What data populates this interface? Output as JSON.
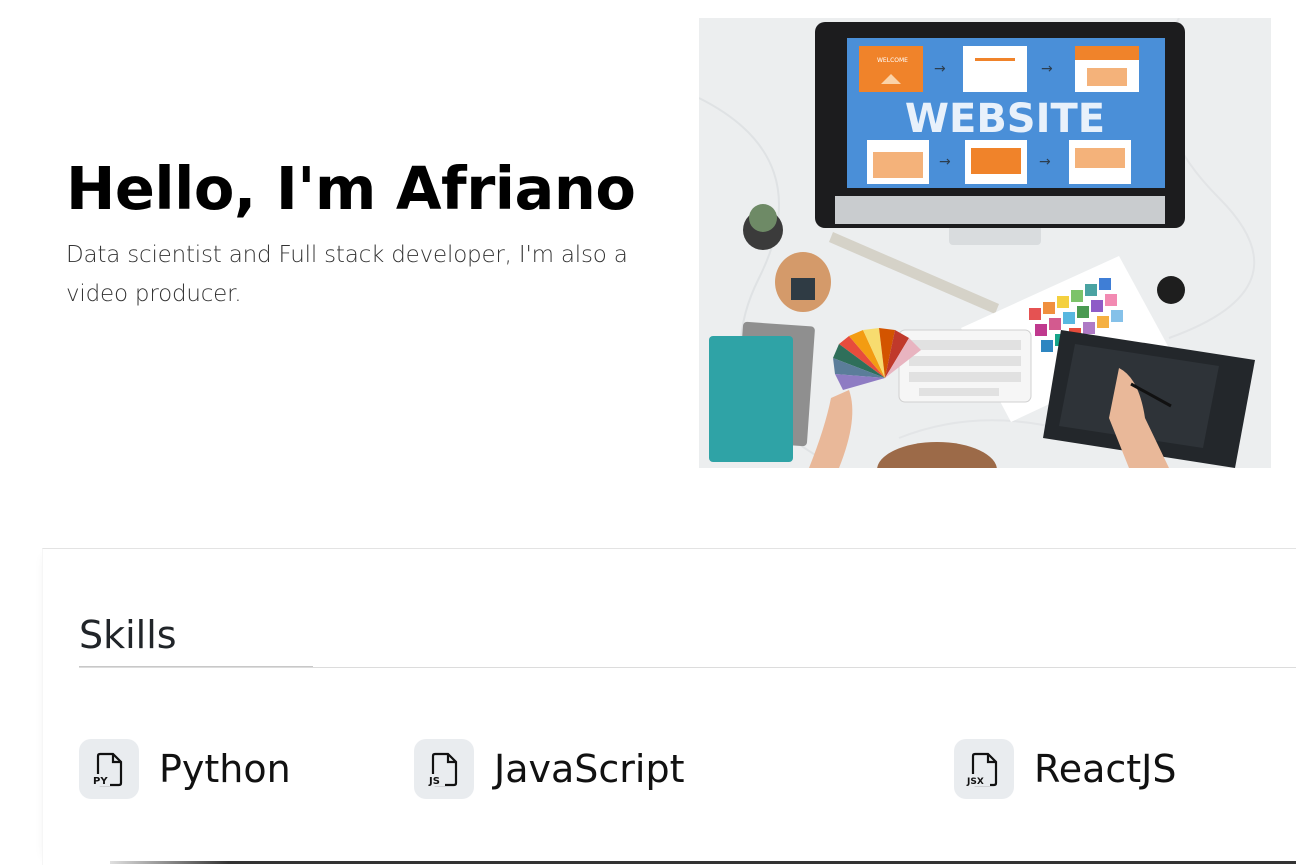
{
  "hero": {
    "title": "Hello, I'm Afriano",
    "subtitle": "Data scientist and Full stack developer, I'm also a video producer.",
    "image": {
      "monitor_text": "WEBSITE",
      "monitor_welcome": "WELCOME"
    }
  },
  "skills": {
    "heading": "Skills",
    "items": [
      {
        "label": "Python",
        "icon": "file-py-icon",
        "icon_text": "PY"
      },
      {
        "label": "JavaScript",
        "icon": "file-js-icon",
        "icon_text": "JS"
      },
      {
        "label": "ReactJS",
        "icon": "file-jsx-icon",
        "icon_text": "JSX"
      }
    ]
  },
  "colors": {
    "monitor_screen": "#4a8fd8",
    "accent_orange": "#f0832a",
    "skill_icon_bg": "#e9ecef"
  }
}
